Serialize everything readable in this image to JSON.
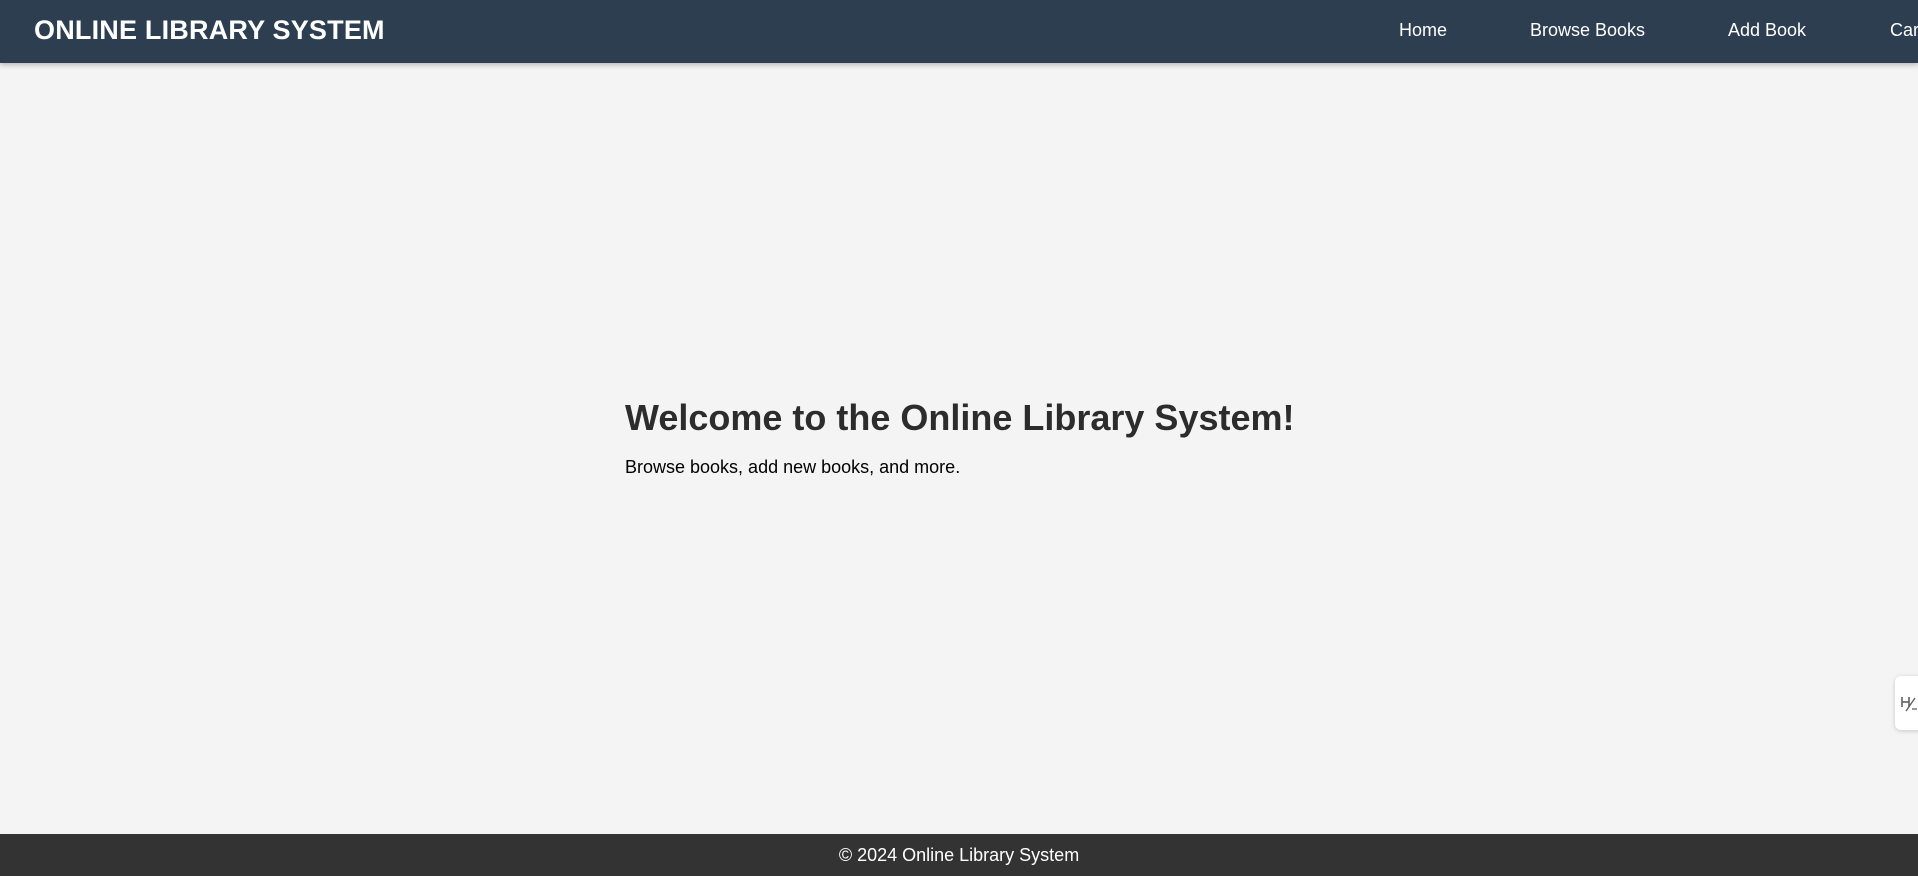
{
  "header": {
    "brand": "ONLINE LIBRARY SYSTEM",
    "nav": [
      {
        "label": "Home"
      },
      {
        "label": "Browse Books"
      },
      {
        "label": "Add Book"
      },
      {
        "label": "Car"
      }
    ]
  },
  "main": {
    "title": "Welcome to the Online Library System!",
    "subtitle": "Browse books, add new books, and more."
  },
  "side_tab": {
    "icon": "translate-icon"
  },
  "footer": {
    "text": "© 2024 Online Library System"
  },
  "colors": {
    "navbar": "#2c3e50",
    "background": "#f4f4f4",
    "footer": "#333333",
    "text_dark": "#2c2c2c",
    "text_light": "#ffffff"
  }
}
